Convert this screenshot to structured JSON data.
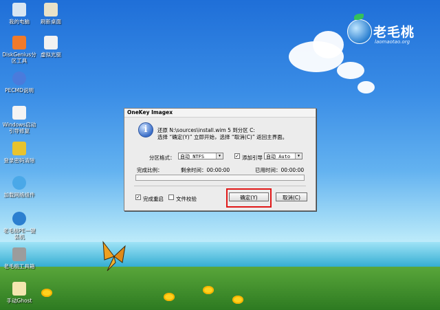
{
  "desktop": {
    "icons": [
      {
        "name": "my-computer-icon",
        "label": "我的电脑",
        "color": "#d9e6f2"
      },
      {
        "name": "refresh-desktop-icon",
        "label": "刷新桌面",
        "color": "#e9e2c8"
      },
      {
        "name": "diskgenius-icon",
        "label": "DiskGenius分\n区工具",
        "color": "#f07a2a"
      },
      {
        "name": "virtual-drive-icon",
        "label": "虚拟光驱",
        "color": "#f2f2f2"
      },
      {
        "name": "help-icon",
        "label": "PECMD说明",
        "color": "#4a7bdc"
      },
      {
        "name": "windows-boot-repair-icon",
        "label": "Windows启动\n引导修复",
        "color": "#f4f4f4"
      },
      {
        "name": "password-tool-icon",
        "label": "登录密码清除",
        "color": "#e8c32e"
      },
      {
        "name": "network-component-icon",
        "label": "加载网络组件",
        "color": "#4aa8e8"
      },
      {
        "name": "one-key-install-icon",
        "label": "老毛桃PE一键\n装机",
        "color": "#2b7fd0"
      },
      {
        "name": "dos-tool-icon",
        "label": "老毛桃工具箱",
        "color": "#9c9c9c"
      },
      {
        "name": "ghost-icon",
        "label": "手动Ghost",
        "color": "#f4e6b0"
      }
    ],
    "logo": {
      "name": "老毛桃",
      "url": "laomaotao.org"
    }
  },
  "dialog": {
    "title": "OneKey Imagex",
    "message_line1": "还原 N:\\sources\\install.wim 5 到分区 C:",
    "message_line2": "选择 “确定(Y)” 立即开始，选择 “取消(C)” 返回主界面。",
    "partition_format_label": "分区格式：",
    "partition_format_value": "自动 NTFS",
    "add_boot_label": "添加引导",
    "add_boot_value": "自动 Auto",
    "add_boot_checked": "✓",
    "progress_label": "完成比例：",
    "remaining_label": "剩余时间：00:00:00",
    "elapsed_label": "已用时间：00:00:00",
    "progress_percent": 0,
    "reboot_label": "完成重启",
    "reboot_checked": "✓",
    "verify_label": "文件校验",
    "verify_checked": "",
    "ok_label": "确定(Y)",
    "cancel_label": "取消(C)"
  }
}
